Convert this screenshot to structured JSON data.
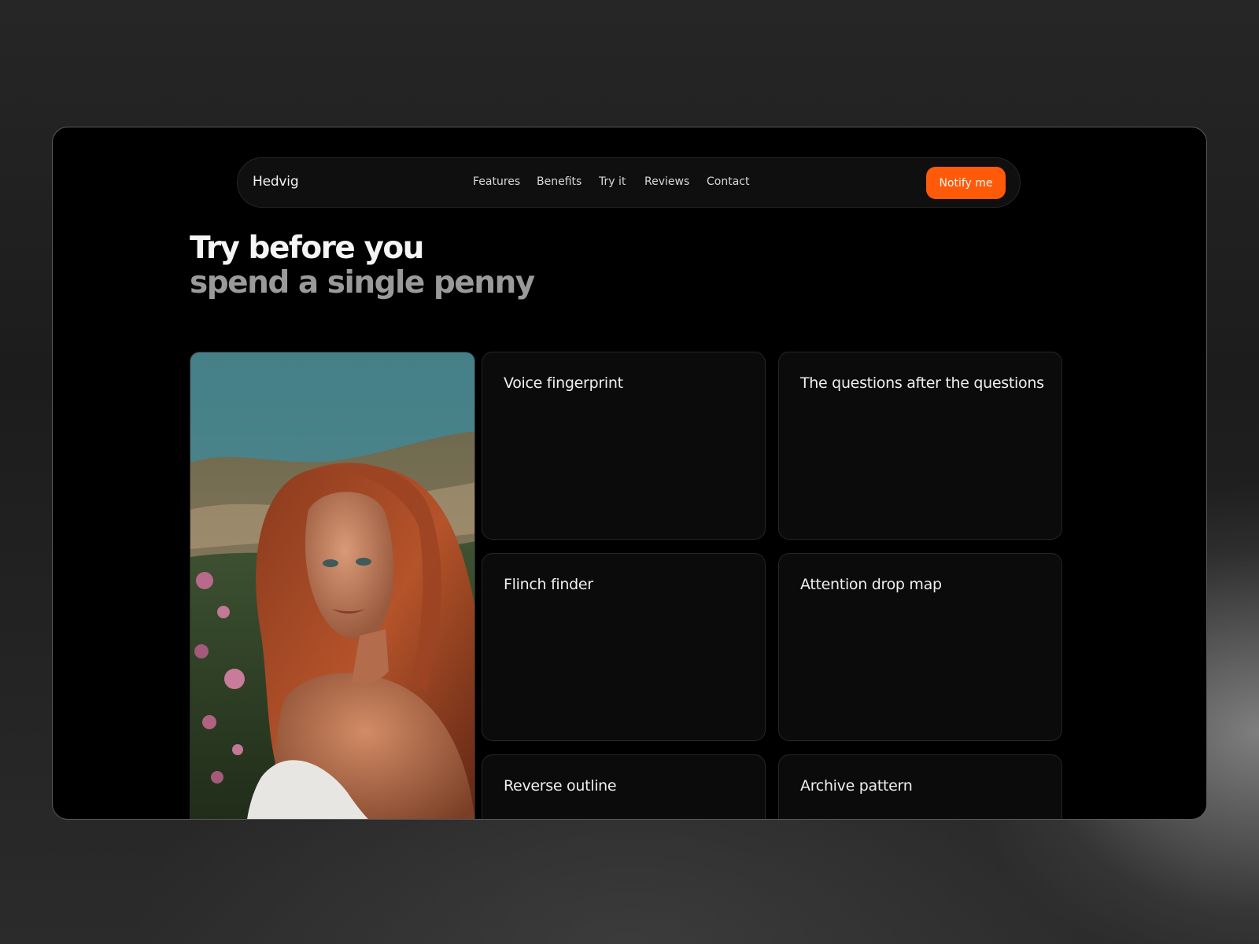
{
  "header": {
    "brand": "Hedvig",
    "nav_links": [
      "Features",
      "Benefits",
      "Try it",
      "Reviews",
      "Contact"
    ],
    "cta_label": "Notify me"
  },
  "hero": {
    "title_line1": "Try before you",
    "title_line2": "spend a single penny"
  },
  "features": [
    {
      "title": "Voice fingerprint"
    },
    {
      "title": "The questions after the questions"
    },
    {
      "title": "Flinch finder"
    },
    {
      "title": "Attention drop map"
    },
    {
      "title": "Reverse outline"
    },
    {
      "title": "Archive pattern"
    }
  ],
  "colors": {
    "accent": "#ff5a0a",
    "page_background": "#000000",
    "card_background": "#0b0b0b",
    "muted_text": "#9a9a9a"
  }
}
